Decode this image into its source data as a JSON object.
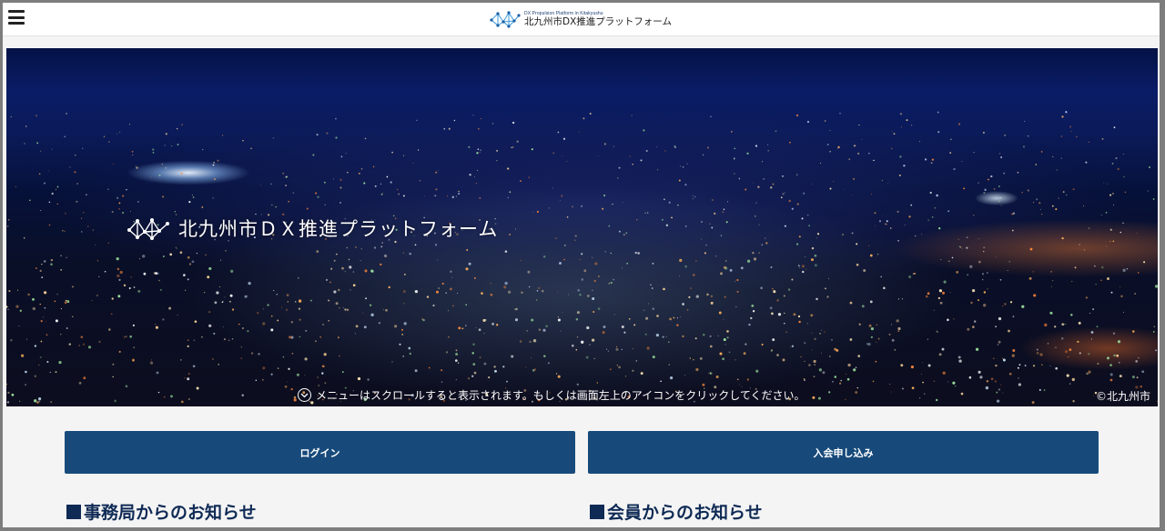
{
  "header": {
    "logo_sub": "DX Propulsion Platform in Kitakyushu",
    "logo_main": "北九州市DX推進プラットフォーム"
  },
  "hero": {
    "title": "北九州市ＤＸ推進プラットフォーム",
    "scroll_note": "メニューはスクロールすると表示されます。もしくは画面左上のアイコンをクリックしてください。",
    "copyright": "©北九州市"
  },
  "buttons": {
    "login": "ログイン",
    "join": "入会申し込み"
  },
  "sections": {
    "office_news": "事務局からのお知らせ",
    "member_news": "会員からのお知らせ"
  },
  "icons": {
    "menu": "hamburger-menu-icon",
    "logo": "network-nodes-logo-icon",
    "scroll": "chevron-down-circle-icon"
  },
  "colors": {
    "primary": "#174a7a",
    "heading": "#0f2a55",
    "logo_accent": "#3b9ad9"
  }
}
